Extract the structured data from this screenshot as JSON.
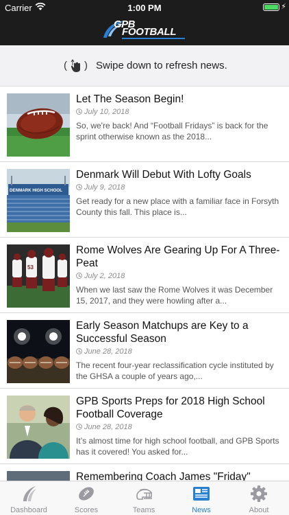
{
  "status_bar": {
    "carrier": "Carrier",
    "time": "1:00 PM",
    "battery_level": 1.0
  },
  "header": {
    "logo_line1": "GPB",
    "logo_line2": "FOOTBALL"
  },
  "refresh_banner": {
    "text": "Swipe down to refresh news.",
    "icon": "swipe-down-hand-icon"
  },
  "news": [
    {
      "title": "Let The Season Begin!",
      "date": "July 10, 2018",
      "excerpt": "So, we're back! And “Football Fridays” is back for the sprint otherwise known as the 2018...",
      "image": "football-on-grass"
    },
    {
      "title": "Denmark Will Debut With Lofty Goals",
      "date": "July 9, 2018",
      "excerpt": "Get ready for a new place with a familiar face in Forsyth County this fall. This place is...",
      "image": "denmark-high-school-stadium",
      "image_text": "DENMARK HIGH SCHOOL"
    },
    {
      "title": "Rome Wolves Are Gearing Up For A Three-Peat",
      "date": "July 2, 2018",
      "excerpt": "When we last saw the Rome Wolves it was December 15, 2017, and they were howling after a...",
      "image": "rome-wolves-players"
    },
    {
      "title": "Early Season Matchups are Key to a Successful Season",
      "date": "June 28, 2018",
      "excerpt": "The recent four-year reclassification cycle instituted by the GHSA a couple of years ago,...",
      "image": "helmets-under-lights"
    },
    {
      "title": "GPB Sports Preps for 2018 High School Football Coverage",
      "date": "June 28, 2018",
      "excerpt": "It’s almost time for high school football, and GPB Sports has it covered! You asked for...",
      "image": "gpb-hosts"
    },
    {
      "title": "Remembering Coach James \"Friday\"",
      "date": "",
      "excerpt": "",
      "image": "coach-photo"
    }
  ],
  "tabs": [
    {
      "label": "Dashboard",
      "icon": "dashboard-swoosh-icon",
      "active": false
    },
    {
      "label": "Scores",
      "icon": "football-icon",
      "active": false
    },
    {
      "label": "Teams",
      "icon": "helmet-icon",
      "active": false
    },
    {
      "label": "News",
      "icon": "newspaper-icon",
      "active": true
    },
    {
      "label": "About",
      "icon": "gear-icon",
      "active": false
    }
  ],
  "colors": {
    "header_bg": "#1c1c1c",
    "accent": "#2a80d0",
    "battery": "#4cd964",
    "tab_inactive": "#8e8e93"
  }
}
